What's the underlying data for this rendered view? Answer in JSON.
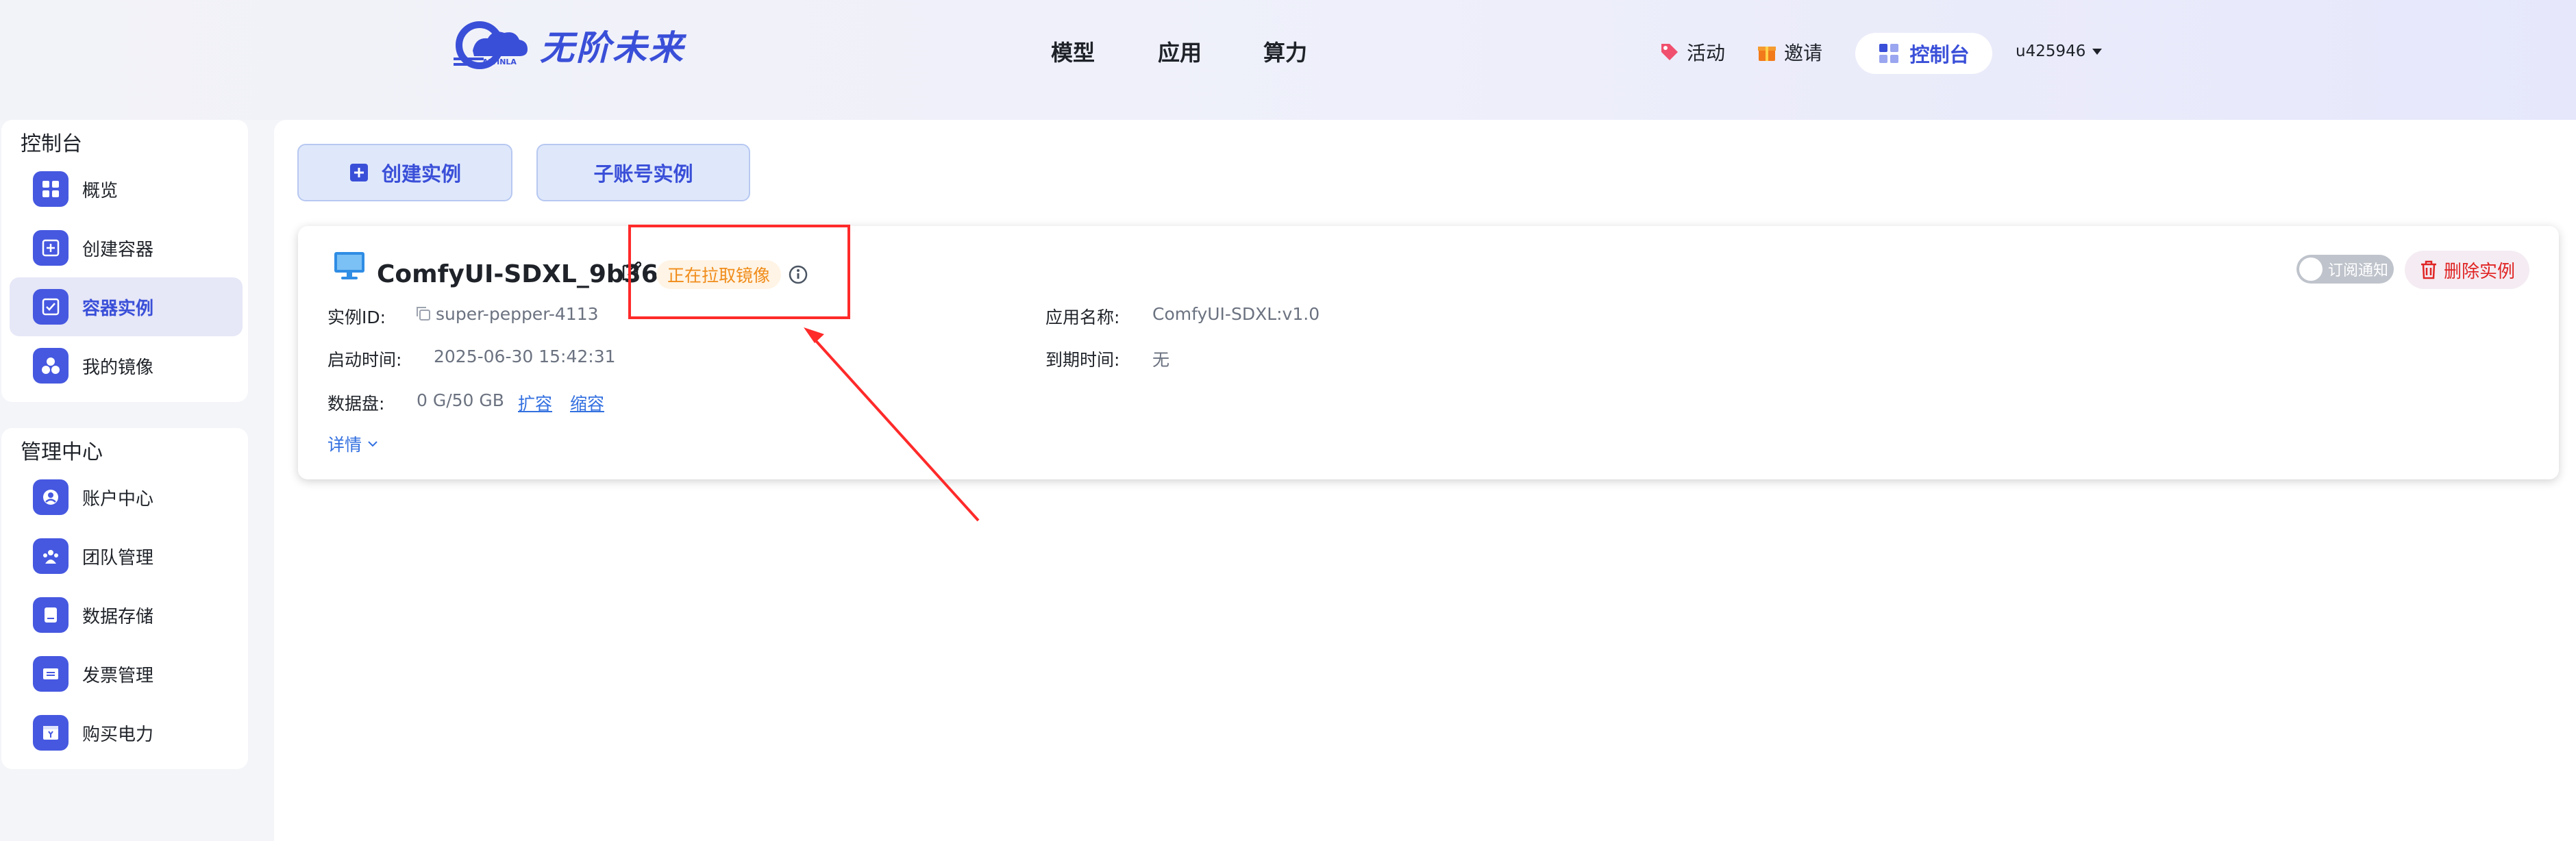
{
  "brand": {
    "name": "无阶未来",
    "sub": "AIVINLA"
  },
  "nav": {
    "model": "模型",
    "app": "应用",
    "compute": "算力"
  },
  "topright": {
    "activity": "活动",
    "invite": "邀请",
    "console": "控制台",
    "user": "u425946"
  },
  "sidebar": {
    "section1": "控制台",
    "items1": [
      {
        "label": "概览",
        "icon": "grid-icon"
      },
      {
        "label": "创建容器",
        "icon": "plus-box-icon"
      },
      {
        "label": "容器实例",
        "icon": "container-icon"
      },
      {
        "label": "我的镜像",
        "icon": "circles-icon"
      }
    ],
    "section2": "管理中心",
    "items2": [
      {
        "label": "账户中心",
        "icon": "account-icon"
      },
      {
        "label": "团队管理",
        "icon": "team-icon"
      },
      {
        "label": "数据存储",
        "icon": "storage-icon"
      },
      {
        "label": "发票管理",
        "icon": "invoice-icon"
      },
      {
        "label": "购买电力",
        "icon": "buy-power-icon"
      }
    ]
  },
  "actions": {
    "create": "创建实例",
    "sub": "子账号实例"
  },
  "instance": {
    "name": "ComfyUI-SDXL_9b36",
    "status": "正在拉取镜像",
    "id_label": "实例ID:",
    "id_value": "super-pepper-4113",
    "start_label": "启动时间:",
    "start_value": "2025-06-30 15:42:31",
    "disk_label": "数据盘:",
    "disk_value": "0 G/50 GB",
    "expand": "扩容",
    "shrink": "缩容",
    "details": "详情",
    "app_label": "应用名称:",
    "app_value": "ComfyUI-SDXL:v1.0",
    "expire_label": "到期时间:",
    "expire_value": "无",
    "subscribe": "订阅通知",
    "delete": "删除实例"
  },
  "colors": {
    "accent": "#3a4fd8",
    "status": "#f08c1a",
    "danger": "#e02424",
    "annotation": "#ff2a2a"
  }
}
